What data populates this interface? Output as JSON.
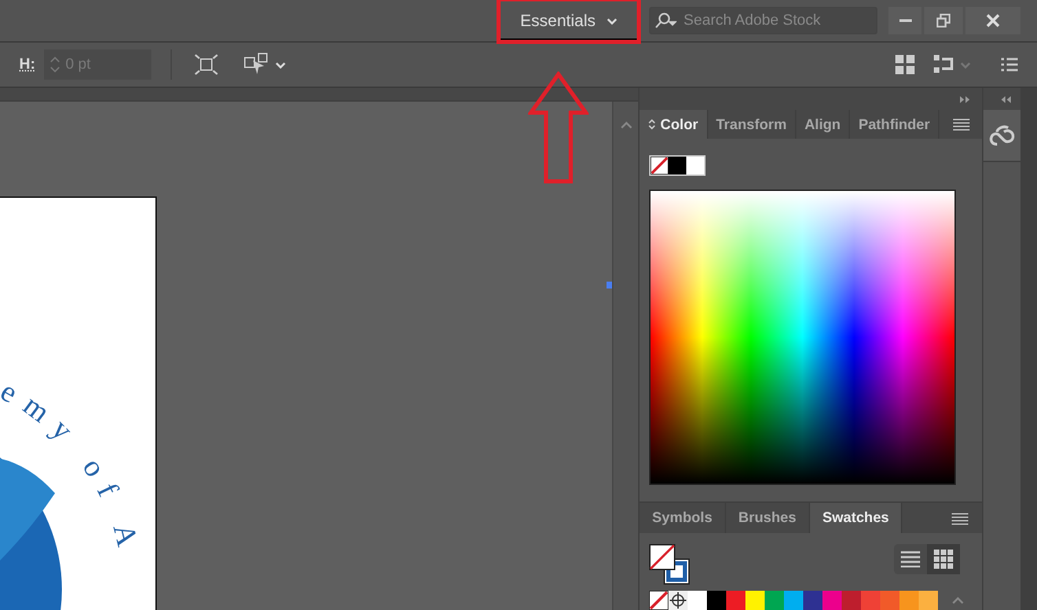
{
  "workspace_switcher": {
    "label": "Essentials",
    "highlighted": true
  },
  "annotation": {
    "arrow": true
  },
  "search": {
    "placeholder": "Search Adobe Stock"
  },
  "control_bar": {
    "height_label": "H:",
    "height_field": {
      "placeholder": "0 pt",
      "disabled": true
    }
  },
  "artboard": {
    "logo_text": "emy of A"
  },
  "color_panel": {
    "tabs": [
      {
        "label": "Color",
        "selected": true,
        "collapsible": true
      },
      {
        "label": "Transform",
        "selected": false,
        "collapsible": false
      },
      {
        "label": "Align",
        "selected": false,
        "collapsible": false
      },
      {
        "label": "Pathfinder",
        "selected": false,
        "collapsible": false
      }
    ],
    "chips": [
      {
        "kind": "none"
      },
      {
        "kind": "solid",
        "color": "#000000"
      },
      {
        "kind": "solid",
        "color": "#ffffff"
      }
    ]
  },
  "swatches_panel": {
    "tabs": [
      {
        "label": "Symbols",
        "selected": false
      },
      {
        "label": "Brushes",
        "selected": false
      },
      {
        "label": "Swatches",
        "selected": true
      }
    ],
    "views": [
      {
        "kind": "list",
        "selected": false
      },
      {
        "kind": "grid",
        "selected": true
      }
    ],
    "swatches": [
      {
        "kind": "none"
      },
      {
        "kind": "registration"
      },
      {
        "kind": "solid",
        "color": "#ffffff"
      },
      {
        "kind": "solid",
        "color": "#000000"
      },
      {
        "kind": "solid",
        "color": "#ed1c24"
      },
      {
        "kind": "solid",
        "color": "#fff200"
      },
      {
        "kind": "solid",
        "color": "#00a651"
      },
      {
        "kind": "solid",
        "color": "#00aeef"
      },
      {
        "kind": "solid",
        "color": "#2e3192"
      },
      {
        "kind": "solid",
        "color": "#ec008c"
      },
      {
        "kind": "solid",
        "color": "#be1e2d"
      },
      {
        "kind": "solid",
        "color": "#ef4136"
      },
      {
        "kind": "solid",
        "color": "#f15a29"
      },
      {
        "kind": "solid",
        "color": "#f7941d"
      },
      {
        "kind": "solid",
        "color": "#fbb040"
      }
    ]
  }
}
